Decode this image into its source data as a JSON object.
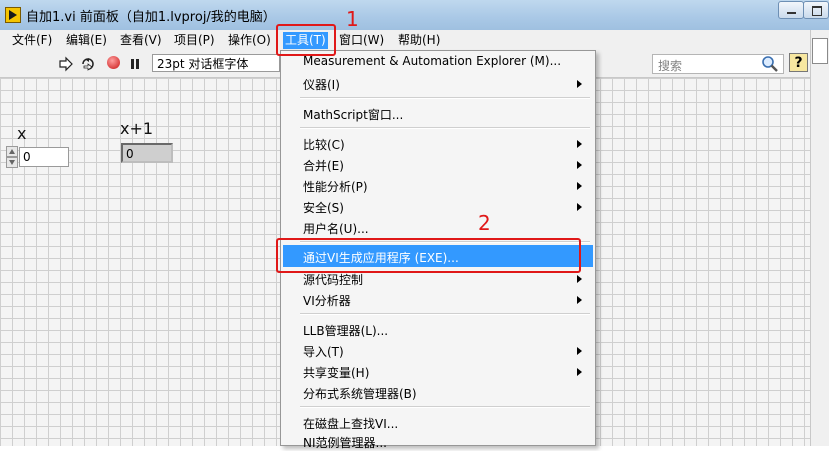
{
  "window": {
    "title": "自加1.vi 前面板（自加1.lvproj/我的电脑）"
  },
  "menubar": {
    "items": [
      "文件(F)",
      "编辑(E)",
      "查看(V)",
      "项目(P)",
      "操作(O)",
      "工具(T)",
      "窗口(W)",
      "帮助(H)"
    ],
    "active": "工具(T)"
  },
  "toolbar": {
    "font": "23pt 对话框字体",
    "search_placeholder": "搜索",
    "help_label": "?"
  },
  "front_panel": {
    "control": {
      "label": "x",
      "value": "0"
    },
    "indicator": {
      "label": "x+1",
      "value": "0"
    }
  },
  "tools_menu": {
    "items": [
      {
        "label": "Measurement & Automation Explorer (M)...",
        "submenu": false
      },
      {
        "label": "仪器(I)",
        "submenu": true
      },
      {
        "label": "MathScript窗口...",
        "submenu": false
      },
      {
        "label": "比较(C)",
        "submenu": true
      },
      {
        "label": "合并(E)",
        "submenu": true
      },
      {
        "label": "性能分析(P)",
        "submenu": true
      },
      {
        "label": "安全(S)",
        "submenu": true
      },
      {
        "label": "用户名(U)...",
        "submenu": false
      },
      {
        "label": "通过VI生成应用程序 (EXE)...",
        "submenu": false,
        "highlighted": true
      },
      {
        "label": "源代码控制",
        "submenu": true
      },
      {
        "label": "VI分析器",
        "submenu": true
      },
      {
        "label": "LLB管理器(L)...",
        "submenu": false
      },
      {
        "label": "导入(T)",
        "submenu": true
      },
      {
        "label": "共享变量(H)",
        "submenu": true
      },
      {
        "label": "分布式系统管理器(B)",
        "submenu": false
      },
      {
        "label": "在磁盘上查找VI...",
        "submenu": false
      },
      {
        "label": "NI范例管理器...",
        "submenu": false
      }
    ]
  },
  "annotations": {
    "step1": "1",
    "step2": "2",
    "color": "#e01818"
  },
  "colors": {
    "highlight": "#3399ff",
    "annotation": "#e01818"
  }
}
